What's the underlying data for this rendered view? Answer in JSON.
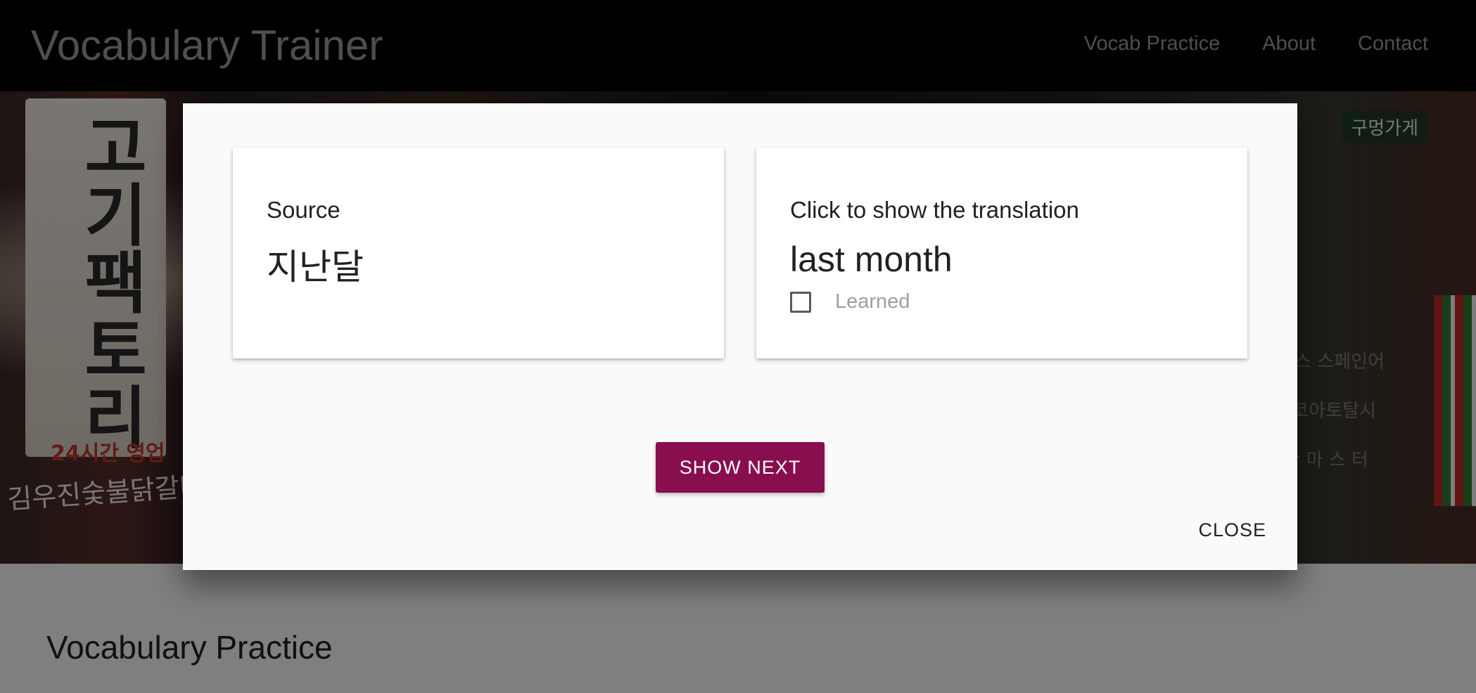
{
  "navbar": {
    "brand": "Vocabulary Trainer",
    "links": [
      "Vocab Practice",
      "About",
      "Contact"
    ]
  },
  "hero": {
    "sign_text": "고기팩토리",
    "sign_subtext": "24시간 영업",
    "sign_bottom": "김우진숯불닭갈비",
    "right_sign": "구멍가게",
    "right_lines": [
      "엘리스 스페인어",
      "(주)코아토탈시",
      "유 한 마 스 터"
    ]
  },
  "section": {
    "title": "Vocabulary Practice"
  },
  "modal": {
    "source_card": {
      "label": "Source",
      "word": "지난달"
    },
    "translation_card": {
      "label": "Click to show the translation",
      "word": "last month",
      "checkbox_label": "Learned",
      "checked": false
    },
    "show_next_label": "Show next",
    "close_label": "Close"
  },
  "colors": {
    "accent": "#880e4f",
    "navbar_bg": "#000000",
    "nav_text": "#9e9e9e",
    "modal_bg": "#fafafa"
  }
}
